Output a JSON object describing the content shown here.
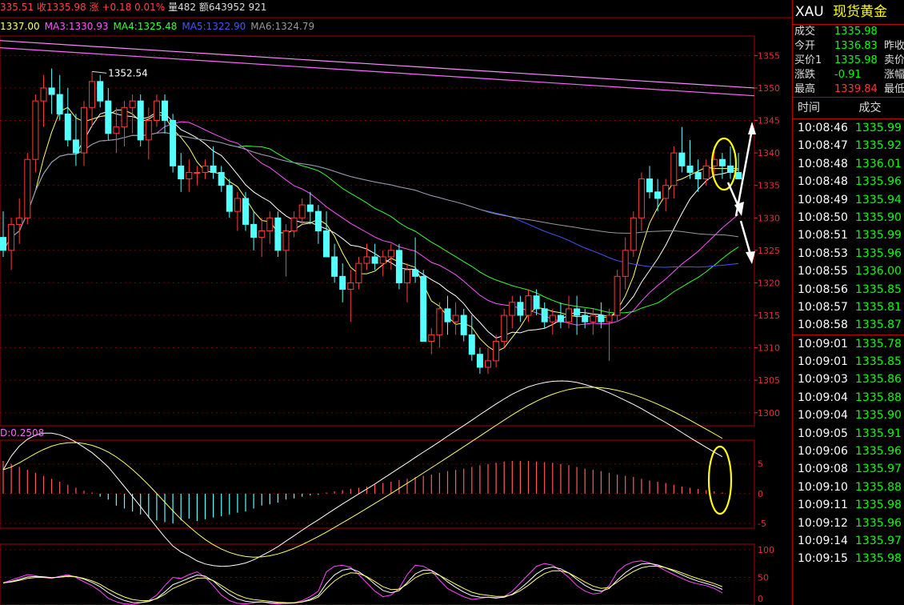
{
  "header": {
    "items": [
      {
        "text": "335.51",
        "color": "#ff4444"
      },
      {
        "text": "收1335.98",
        "color": "#ff4444"
      },
      {
        "text": "涨 +0.18 0.01%",
        "color": "#ff4444"
      },
      {
        "text": "量482 额643952 921",
        "color": "#dddddd"
      }
    ]
  },
  "ma_bar": [
    {
      "text": "1337.00",
      "color": "#ffff66"
    },
    {
      "text": "MA3:1330.93",
      "color": "#ff55ff"
    },
    {
      "text": "MA4:1325.48",
      "color": "#33ff33"
    },
    {
      "text": "MA5:1322.90",
      "color": "#4455ff"
    },
    {
      "text": "MA6:1324.79",
      "color": "#999999"
    }
  ],
  "macd_label": "D:0.2508",
  "chart_data": {
    "type": "candlestick",
    "main_axis": {
      "range": [
        1298,
        1358
      ],
      "ticks": [
        1355,
        1350,
        1345,
        1340,
        1335,
        1330,
        1325,
        1320,
        1315,
        1310,
        1305,
        1300
      ]
    },
    "macd_axis": {
      "range": [
        -5.8,
        9
      ],
      "ticks": [
        5,
        0,
        -5
      ]
    },
    "kdj_axis": {
      "range": [
        0,
        110
      ],
      "ticks": [
        100,
        50,
        0
      ]
    },
    "annotation_high": "1352.54",
    "candles": [
      [
        1327,
        1331,
        1324,
        1325
      ],
      [
        1325,
        1330,
        1322,
        1329
      ],
      [
        1329,
        1333,
        1326,
        1330
      ],
      [
        1330,
        1340,
        1329,
        1339
      ],
      [
        1339,
        1349,
        1337,
        1348
      ],
      [
        1348,
        1352,
        1344,
        1350
      ],
      [
        1350,
        1353,
        1346,
        1349
      ],
      [
        1349,
        1352,
        1345,
        1346
      ],
      [
        1346,
        1350,
        1341,
        1342
      ],
      [
        1342,
        1346,
        1338,
        1340
      ],
      [
        1340,
        1348,
        1338,
        1347
      ],
      [
        1347,
        1352.54,
        1344,
        1351
      ],
      [
        1351,
        1352,
        1347,
        1348
      ],
      [
        1348,
        1350,
        1342,
        1343
      ],
      [
        1343,
        1347,
        1340,
        1344
      ],
      [
        1344,
        1348,
        1341,
        1347
      ],
      [
        1347,
        1349,
        1343,
        1348
      ],
      [
        1348,
        1349,
        1341,
        1342
      ],
      [
        1342,
        1347,
        1339,
        1345
      ],
      [
        1345,
        1349,
        1344,
        1348
      ],
      [
        1348,
        1349,
        1343,
        1345
      ],
      [
        1345,
        1346,
        1337,
        1338
      ],
      [
        1338,
        1340,
        1334,
        1336
      ],
      [
        1336,
        1339,
        1334,
        1337
      ],
      [
        1337,
        1338,
        1335,
        1337
      ],
      [
        1337,
        1339,
        1336,
        1338
      ],
      [
        1338,
        1341,
        1336,
        1337
      ],
      [
        1337,
        1338,
        1334,
        1335
      ],
      [
        1335,
        1336,
        1330,
        1331
      ],
      [
        1331,
        1334,
        1328,
        1333
      ],
      [
        1333,
        1334,
        1328,
        1329
      ],
      [
        1329,
        1331,
        1325,
        1327
      ],
      [
        1327,
        1330,
        1324,
        1328
      ],
      [
        1328,
        1331,
        1326,
        1330
      ],
      [
        1330,
        1331,
        1324,
        1325
      ],
      [
        1325,
        1329,
        1321,
        1328
      ],
      [
        1328,
        1331,
        1327,
        1330
      ],
      [
        1330,
        1333,
        1329,
        1332
      ],
      [
        1332,
        1334,
        1329,
        1331
      ],
      [
        1331,
        1332,
        1326,
        1328
      ],
      [
        1328,
        1331,
        1325,
        1324
      ],
      [
        1324,
        1326,
        1320,
        1321
      ],
      [
        1321,
        1323,
        1317,
        1319
      ],
      [
        1319,
        1322,
        1314,
        1320
      ],
      [
        1320,
        1324,
        1319,
        1323
      ],
      [
        1323,
        1326,
        1322,
        1324
      ],
      [
        1324,
        1326,
        1322,
        1323
      ],
      [
        1323,
        1325,
        1321,
        1324
      ],
      [
        1324,
        1326,
        1322,
        1325
      ],
      [
        1325,
        1326,
        1319,
        1320
      ],
      [
        1320,
        1323,
        1317,
        1322
      ],
      [
        1322,
        1327,
        1320,
        1321
      ],
      [
        1321,
        1322,
        1312,
        1311
      ],
      [
        1311,
        1313,
        1309,
        1312
      ],
      [
        1312,
        1317,
        1310,
        1316
      ],
      [
        1316,
        1318,
        1312,
        1314
      ],
      [
        1314,
        1317,
        1312,
        1315
      ],
      [
        1315,
        1316,
        1311,
        1312
      ],
      [
        1312,
        1315,
        1308,
        1309
      ],
      [
        1309,
        1310,
        1306,
        1307
      ],
      [
        1307,
        1310,
        1306,
        1308
      ],
      [
        1308,
        1312,
        1307,
        1311
      ],
      [
        1311,
        1316,
        1310,
        1315
      ],
      [
        1315,
        1318,
        1313,
        1317
      ],
      [
        1317,
        1318,
        1314,
        1315
      ],
      [
        1315,
        1319,
        1314,
        1318
      ],
      [
        1318,
        1319,
        1315,
        1316
      ],
      [
        1316,
        1317,
        1313,
        1314
      ],
      [
        1314,
        1316,
        1312,
        1315
      ],
      [
        1315,
        1317,
        1313,
        1314
      ],
      [
        1314,
        1318,
        1313,
        1316
      ],
      [
        1316,
        1318,
        1312,
        1315
      ],
      [
        1315,
        1316,
        1313,
        1314
      ],
      [
        1314,
        1316,
        1312,
        1315
      ],
      [
        1315,
        1317,
        1313,
        1314
      ],
      [
        1314,
        1316,
        1308,
        1315
      ],
      [
        1315,
        1322,
        1314,
        1321
      ],
      [
        1321,
        1327,
        1319,
        1325
      ],
      [
        1325,
        1331,
        1324,
        1330
      ],
      [
        1330,
        1337,
        1328,
        1336
      ],
      [
        1336,
        1338,
        1333,
        1334
      ],
      [
        1334,
        1336,
        1331,
        1333
      ],
      [
        1333,
        1336,
        1331,
        1335
      ],
      [
        1335,
        1341,
        1333,
        1340
      ],
      [
        1340,
        1344,
        1337,
        1338
      ],
      [
        1338,
        1342,
        1336,
        1337
      ],
      [
        1337,
        1339,
        1334,
        1336
      ],
      [
        1336,
        1339,
        1335,
        1338
      ],
      [
        1338,
        1341,
        1336,
        1339
      ],
      [
        1339,
        1340,
        1336,
        1338
      ],
      [
        1338,
        1341,
        1336,
        1337
      ],
      [
        1337,
        1340,
        1336,
        1336
      ]
    ],
    "macd_hist": [
      5.5,
      5,
      4.5,
      4,
      3.5,
      3,
      2.5,
      2,
      1.5,
      1,
      0.5,
      0.2,
      -0.5,
      -1,
      -2,
      -2.5,
      -3,
      -3.5,
      -4,
      -4.5,
      -4.8,
      -5,
      -4.5,
      -4.2,
      -4.6,
      -4.3,
      -4,
      -3.8,
      -3.5,
      -3.2,
      -3,
      -2.5,
      -2,
      -1.8,
      -1.5,
      -1,
      -0.8,
      -0.5,
      -0.3,
      -0.2,
      0.2,
      0.4,
      0.6,
      0.8,
      1,
      1.2,
      1.5,
      1.8,
      2,
      2.3,
      2.5,
      2.8,
      3,
      3.2,
      3.5,
      3.8,
      4,
      4.2,
      4.5,
      4.8,
      5,
      5.2,
      5.4,
      5.5,
      5.5,
      5.5,
      5.4,
      5.3,
      5.2,
      5,
      4.8,
      4.5,
      4.2,
      4,
      3.8,
      3.5,
      3.2,
      3,
      2.8,
      2.5,
      2.2,
      2,
      1.8,
      1.5,
      1.2,
      1,
      0.8,
      0.6,
      0.4,
      0.2
    ],
    "kdj_k": [
      40,
      45,
      50,
      55,
      53,
      50,
      48,
      52,
      55,
      50,
      42,
      35,
      25,
      12,
      6,
      2,
      1,
      4,
      8,
      18,
      35,
      50,
      48,
      55,
      60,
      50,
      35,
      18,
      8,
      3,
      2,
      4,
      6,
      3,
      2,
      3,
      4,
      8,
      15,
      25,
      60,
      70,
      72,
      68,
      55,
      40,
      25,
      15,
      18,
      30,
      55,
      72,
      70,
      62,
      45,
      30,
      22,
      15,
      10,
      12,
      14,
      12,
      15,
      25,
      40,
      55,
      70,
      75,
      72,
      62,
      50,
      35,
      25,
      20,
      22,
      35,
      60,
      72,
      78,
      80,
      76,
      70,
      62,
      55,
      48,
      42,
      38,
      35,
      30,
      22
    ]
  },
  "side": {
    "code": "XAU",
    "name": "现货黄金",
    "quote_rows": [
      {
        "label": "成交",
        "value": "1335.98",
        "color": "#00ff00",
        "label2": ""
      },
      {
        "label": "今开",
        "value": "1336.83",
        "color": "#00ff00",
        "label2": "昨收"
      },
      {
        "label": "买价1",
        "value": "1335.98",
        "color": "#00ff00",
        "label2": "卖价"
      },
      {
        "label": "涨跌",
        "value": "-0.91",
        "color": "#00ff00",
        "label2": "涨幅"
      },
      {
        "label": "最高",
        "value": "1339.84",
        "color": "#ff3333",
        "label2": "最低"
      }
    ],
    "tick_header": {
      "time": "时间",
      "price": "成交"
    },
    "ticks_a": [
      {
        "t": "10:08:46",
        "p": "1335.99"
      },
      {
        "t": "10:08:47",
        "p": "1335.92"
      },
      {
        "t": "10:08:48",
        "p": "1336.01"
      },
      {
        "t": "10:08:48",
        "p": "1335.96"
      },
      {
        "t": "10:08:49",
        "p": "1335.94"
      },
      {
        "t": "10:08:50",
        "p": "1335.90"
      },
      {
        "t": "10:08:51",
        "p": "1335.99"
      },
      {
        "t": "10:08:53",
        "p": "1335.96"
      },
      {
        "t": "10:08:55",
        "p": "1336.00"
      },
      {
        "t": "10:08:56",
        "p": "1335.85"
      },
      {
        "t": "10:08:57",
        "p": "1335.81"
      },
      {
        "t": "10:08:58",
        "p": "1335.87"
      }
    ],
    "ticks_b": [
      {
        "t": "10:09:01",
        "p": "1335.78"
      },
      {
        "t": "10:09:01",
        "p": "1335.85"
      },
      {
        "t": "10:09:03",
        "p": "1335.86"
      },
      {
        "t": "10:09:04",
        "p": "1335.88"
      },
      {
        "t": "10:09:04",
        "p": "1335.90"
      },
      {
        "t": "10:09:05",
        "p": "1335.91"
      },
      {
        "t": "10:09:06",
        "p": "1335.96"
      },
      {
        "t": "10:09:08",
        "p": "1335.97"
      },
      {
        "t": "10:09:10",
        "p": "1335.88"
      },
      {
        "t": "10:09:11",
        "p": "1335.98"
      },
      {
        "t": "10:09:12",
        "p": "1335.96"
      },
      {
        "t": "10:09:14",
        "p": "1335.97"
      },
      {
        "t": "10:09:15",
        "p": "1335.98"
      }
    ]
  }
}
